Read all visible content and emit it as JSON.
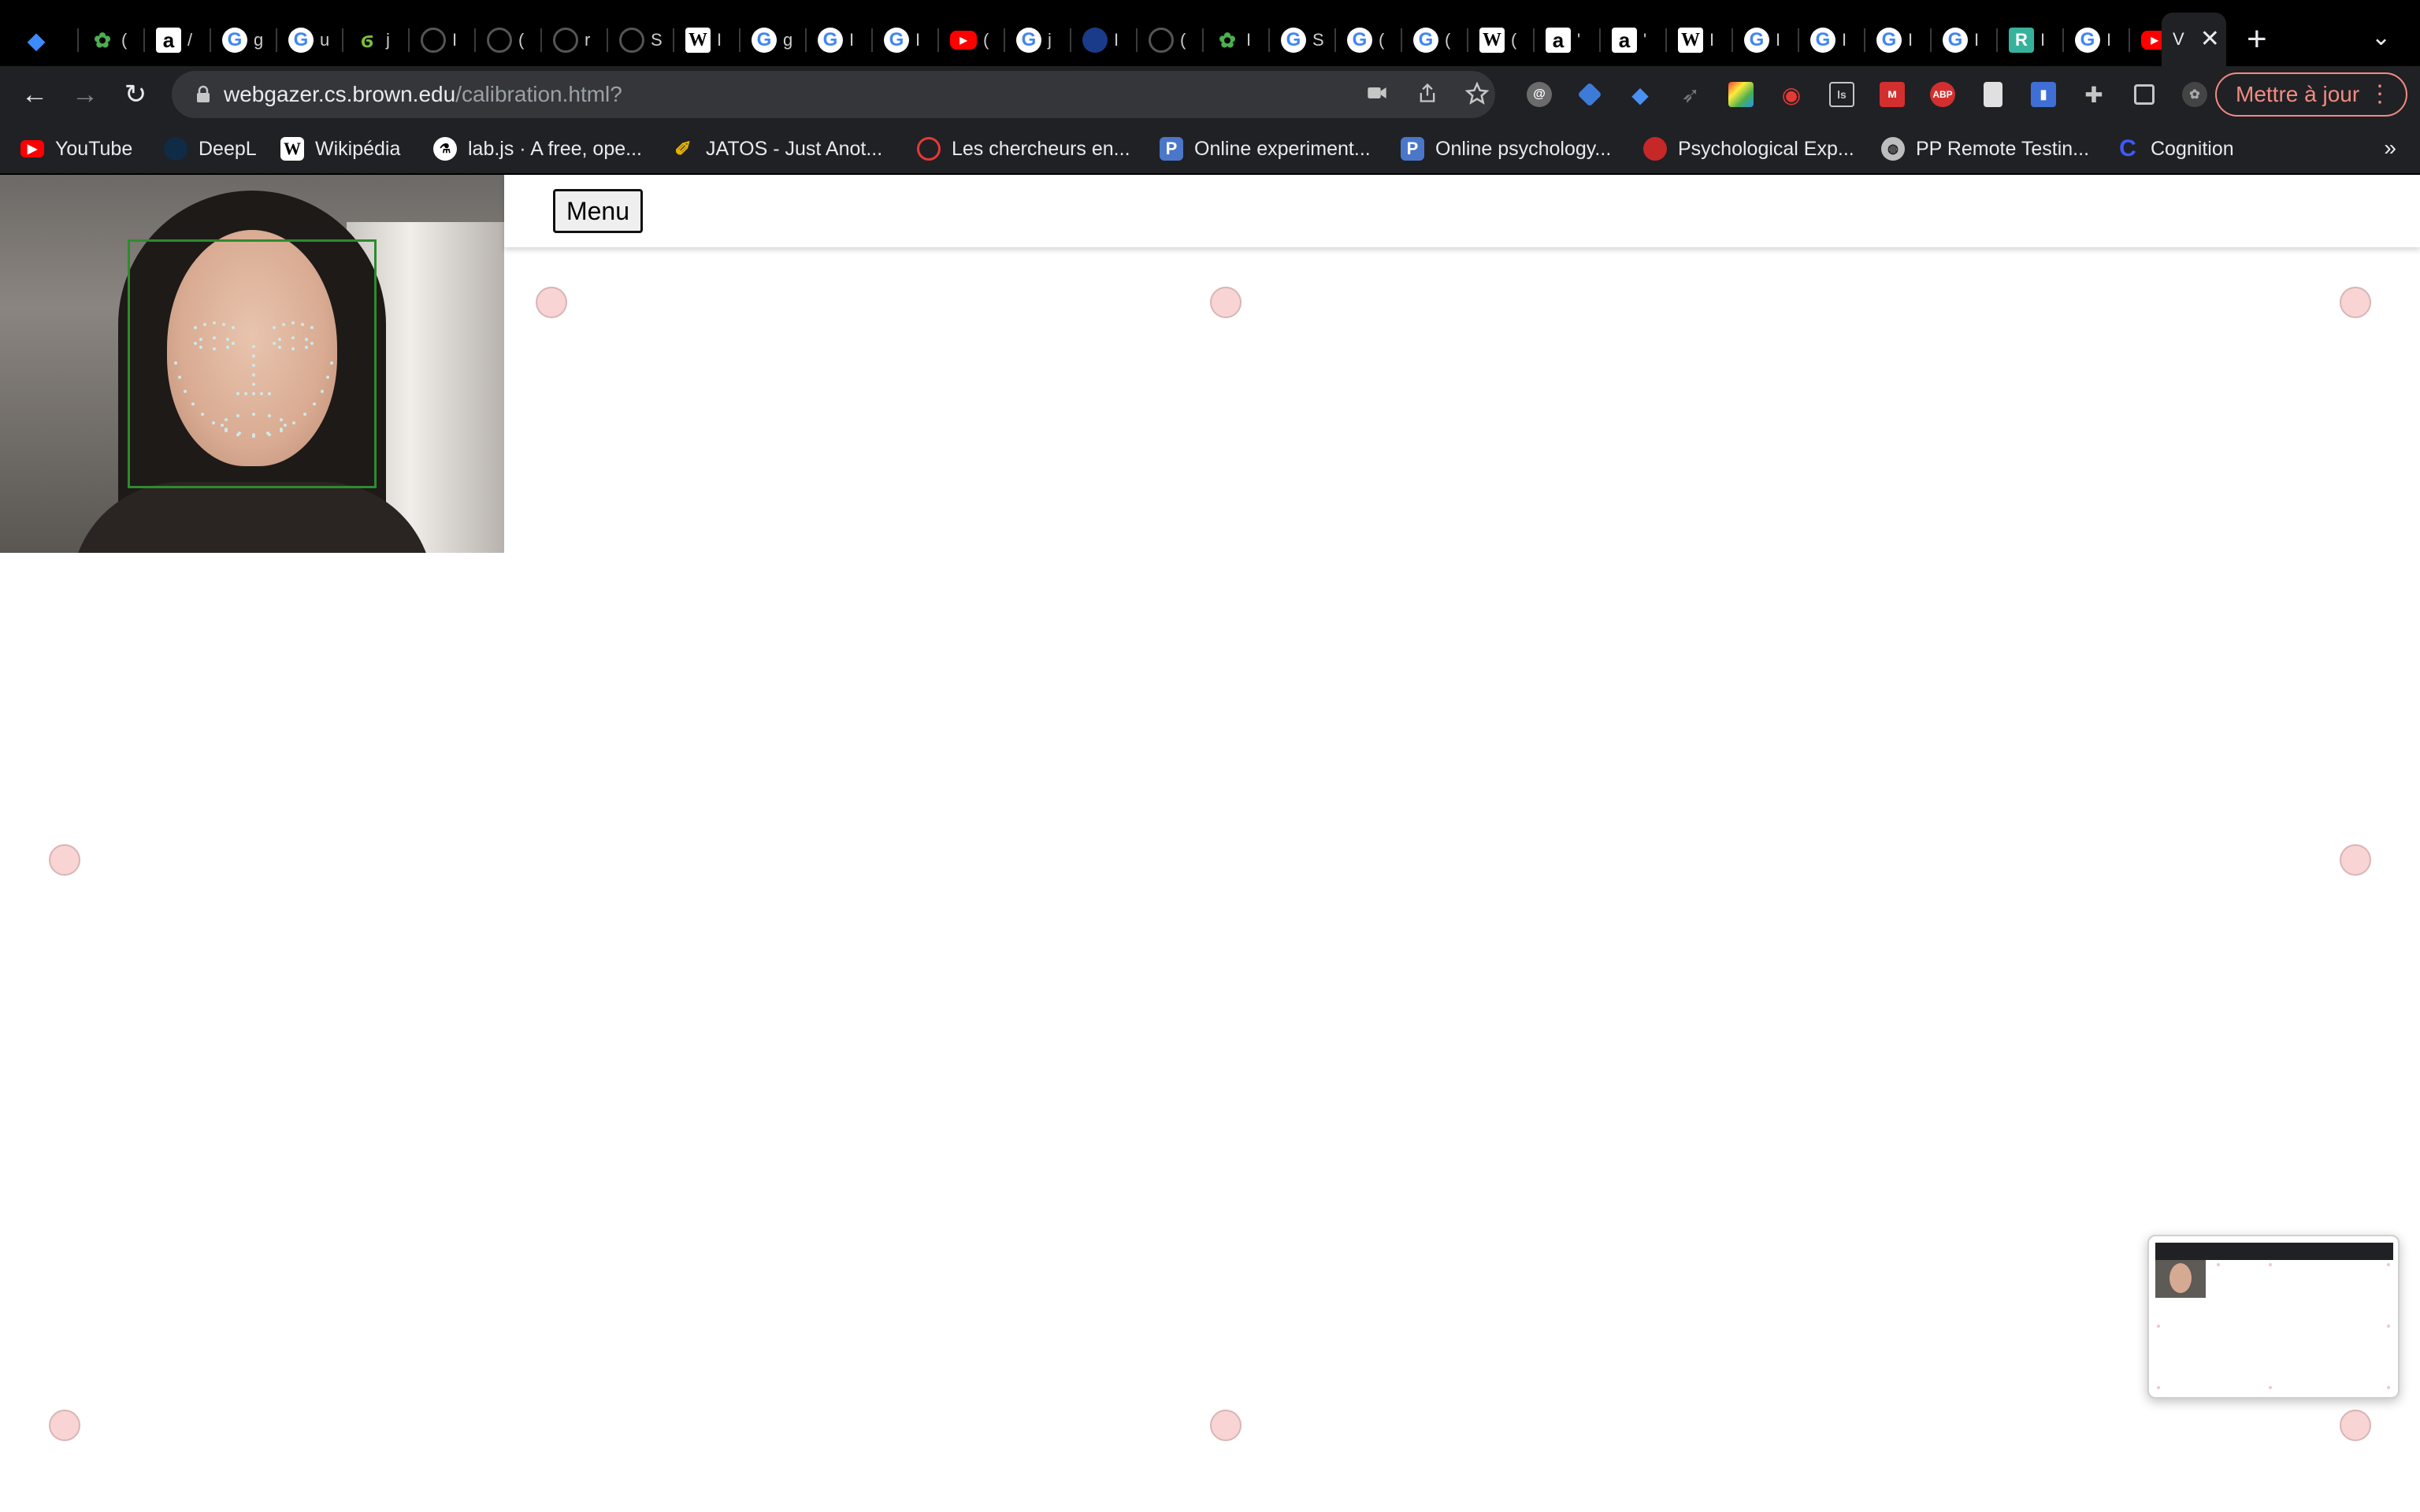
{
  "window": {
    "accent_update_color": "#f28b82",
    "calibration_point_color": "#f8d4d4",
    "face_box_color": "#2e8b2e"
  },
  "tabs": [
    {
      "icon": "gem-icon",
      "letter": ""
    },
    {
      "icon": "brain-icon",
      "letter": "("
    },
    {
      "icon": "amazon-icon",
      "letter": "/"
    },
    {
      "icon": "google-icon",
      "letter": "g"
    },
    {
      "icon": "google-icon",
      "letter": "u"
    },
    {
      "icon": "swirl-icon",
      "letter": "j"
    },
    {
      "icon": "github-icon",
      "letter": "I"
    },
    {
      "icon": "github-icon",
      "letter": "("
    },
    {
      "icon": "github-icon",
      "letter": "r"
    },
    {
      "icon": "github-icon",
      "letter": "S"
    },
    {
      "icon": "wikipedia-icon",
      "letter": "I"
    },
    {
      "icon": "google-icon",
      "letter": "g"
    },
    {
      "icon": "google-icon",
      "letter": "I"
    },
    {
      "icon": "google-icon",
      "letter": "I"
    },
    {
      "icon": "youtube-icon",
      "letter": "("
    },
    {
      "icon": "google-icon",
      "letter": "j"
    },
    {
      "icon": "blue-site-icon",
      "letter": "I"
    },
    {
      "icon": "github-icon",
      "letter": "("
    },
    {
      "icon": "brain-icon",
      "letter": "I"
    },
    {
      "icon": "google-icon",
      "letter": "S"
    },
    {
      "icon": "google-icon",
      "letter": "("
    },
    {
      "icon": "google-icon",
      "letter": "("
    },
    {
      "icon": "wikipedia-icon",
      "letter": "("
    },
    {
      "icon": "amazon-icon",
      "letter": "'"
    },
    {
      "icon": "amazon-icon",
      "letter": "'"
    },
    {
      "icon": "wikipedia-icon",
      "letter": "I"
    },
    {
      "icon": "google-icon",
      "letter": "I"
    },
    {
      "icon": "google-icon",
      "letter": "I"
    },
    {
      "icon": "google-icon",
      "letter": "I"
    },
    {
      "icon": "google-icon",
      "letter": "I"
    },
    {
      "icon": "researchgate-icon",
      "letter": "I"
    },
    {
      "icon": "google-icon",
      "letter": "I"
    },
    {
      "icon": "youtube-icon",
      "letter": "'"
    }
  ],
  "active_tab": {
    "letter": "V",
    "close": "✕"
  },
  "new_tab": "+",
  "tab_search": "⌄",
  "nav": {
    "back": "←",
    "forward": "→",
    "reload": "↻"
  },
  "address": {
    "host": "webgazer.cs.brown.edu",
    "path": "/calibration.html?"
  },
  "omnibox_icons": [
    "camera-icon",
    "share-icon",
    "star-icon"
  ],
  "extensions": [
    "incognito-mail-icon",
    "graduation-cap-icon",
    "gem-icon",
    "rocket-icon",
    "color-palette-icon",
    "eye-icon",
    "ls-icon",
    "mendeley-icon",
    "adblock-icon",
    "document-icon",
    "reader-icon",
    "puzzle-icon",
    "sidepanel-icon",
    "profile-brain-icon"
  ],
  "update_button": {
    "label": "Mettre à jour",
    "menu": "⋮"
  },
  "bookmarks": [
    {
      "label": "YouTube",
      "icon": "youtube-icon",
      "color": "#ff0000"
    },
    {
      "label": "DeepL",
      "icon": "deepl-icon",
      "color": "#0f2b46"
    },
    {
      "label": "Wikipédia",
      "icon": "wikipedia-icon",
      "color": "#ffffff"
    },
    {
      "label": "lab.js · A free, ope...",
      "icon": "labjs-icon",
      "color": "#ffffff"
    },
    {
      "label": "JATOS - Just Anot...",
      "icon": "jatos-icon",
      "color": "#e8b400"
    },
    {
      "label": "Les chercheurs en...",
      "icon": "chat-bubble-icon",
      "color": "#e53935"
    },
    {
      "label": "Online experiment...",
      "icon": "p-icon",
      "color": "#4a77c9"
    },
    {
      "label": "Online psychology...",
      "icon": "p-icon",
      "color": "#4a77c9"
    },
    {
      "label": "Psychological Exp...",
      "icon": "psychopy-icon",
      "color": "#c62828"
    },
    {
      "label": "PP Remote Testin...",
      "icon": "globe-icon",
      "color": "#bdbdbd"
    },
    {
      "label": "Cognition",
      "icon": "cognition-icon",
      "color": "#3d5afe"
    }
  ],
  "bookmarks_more": "»",
  "page": {
    "menu_label": "Menu"
  }
}
